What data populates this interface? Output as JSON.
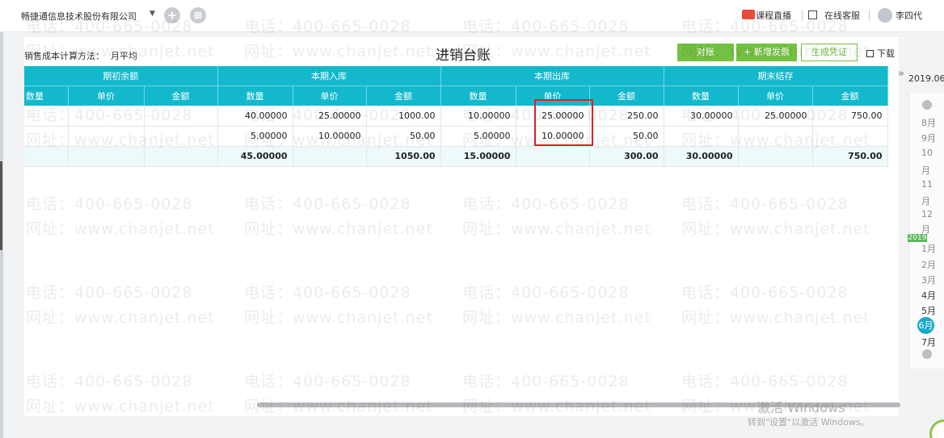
{
  "topbar": {
    "company": "畅捷通信息技术股份有限公司",
    "live": "课程直播",
    "service": "在线客服",
    "user": "李四代"
  },
  "toolbar": {
    "cost_method_label": "销售成本计算方法：",
    "cost_method_value": "月平均",
    "title": "进销台账",
    "reconcile": "对账",
    "new_invoice": "+ 新增发票",
    "gen_voucher": "生成凭证",
    "download": "下载"
  },
  "table": {
    "groups": [
      "期初余额",
      "本期入库",
      "本期出库",
      "期末结存"
    ],
    "columns": [
      "数量",
      "单价",
      "金额",
      "数量",
      "单价",
      "金额",
      "数量",
      "单价",
      "金额",
      "数量",
      "单价",
      "金额"
    ],
    "rows": [
      [
        "",
        "",
        "",
        "40.00000",
        "25.00000",
        "1000.00",
        "10.00000",
        "25.00000",
        "250.00",
        "30.00000",
        "25.00000",
        "750.00"
      ],
      [
        "",
        "",
        "",
        "5.00000",
        "10.00000",
        "50.00",
        "5.00000",
        "10.00000",
        "50.00",
        "",
        "",
        ""
      ]
    ],
    "total": [
      "",
      "",
      "",
      "45.00000",
      "",
      "1050.00",
      "15.00000",
      "",
      "300.00",
      "30.00000",
      "",
      "750.00"
    ]
  },
  "right_panel": {
    "year": "2019.06",
    "months": [
      "8月",
      "9月",
      "10",
      "月",
      "11",
      "月",
      "12",
      "月",
      "2019",
      "1月",
      "2月",
      "3月",
      "4月",
      "5月",
      "6月",
      "7月"
    ]
  },
  "watermark": {
    "phone": "电话：400-665-0028",
    "site": "网址：www.chanjet.net"
  },
  "activation": {
    "line1": "激活 Windows",
    "line2": "转到\"设置\"以激活 Windows。"
  }
}
